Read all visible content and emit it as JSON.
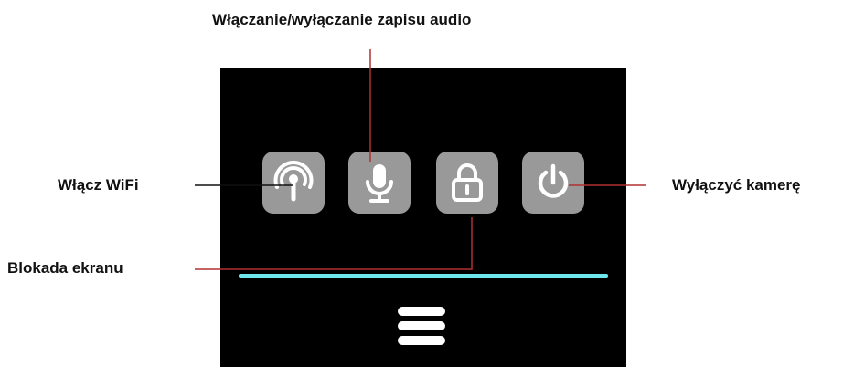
{
  "callouts": {
    "audio": "Włączanie/wyłączanie zapisu audio",
    "wifi": "Włącz WiFi",
    "lock": "Blokada ekranu",
    "power": "Wyłączyć kamerę"
  },
  "colors": {
    "screen_bg": "#000000",
    "icon_bg": "#999999",
    "progress": "#6ee6ec",
    "leader_red": "#b03030",
    "leader_black": "#111111"
  },
  "icons": [
    "wifi-broadcast-icon",
    "microphone-icon",
    "lock-icon",
    "power-icon",
    "hamburger-menu-icon"
  ],
  "progress": {
    "fraction": 1.0
  }
}
